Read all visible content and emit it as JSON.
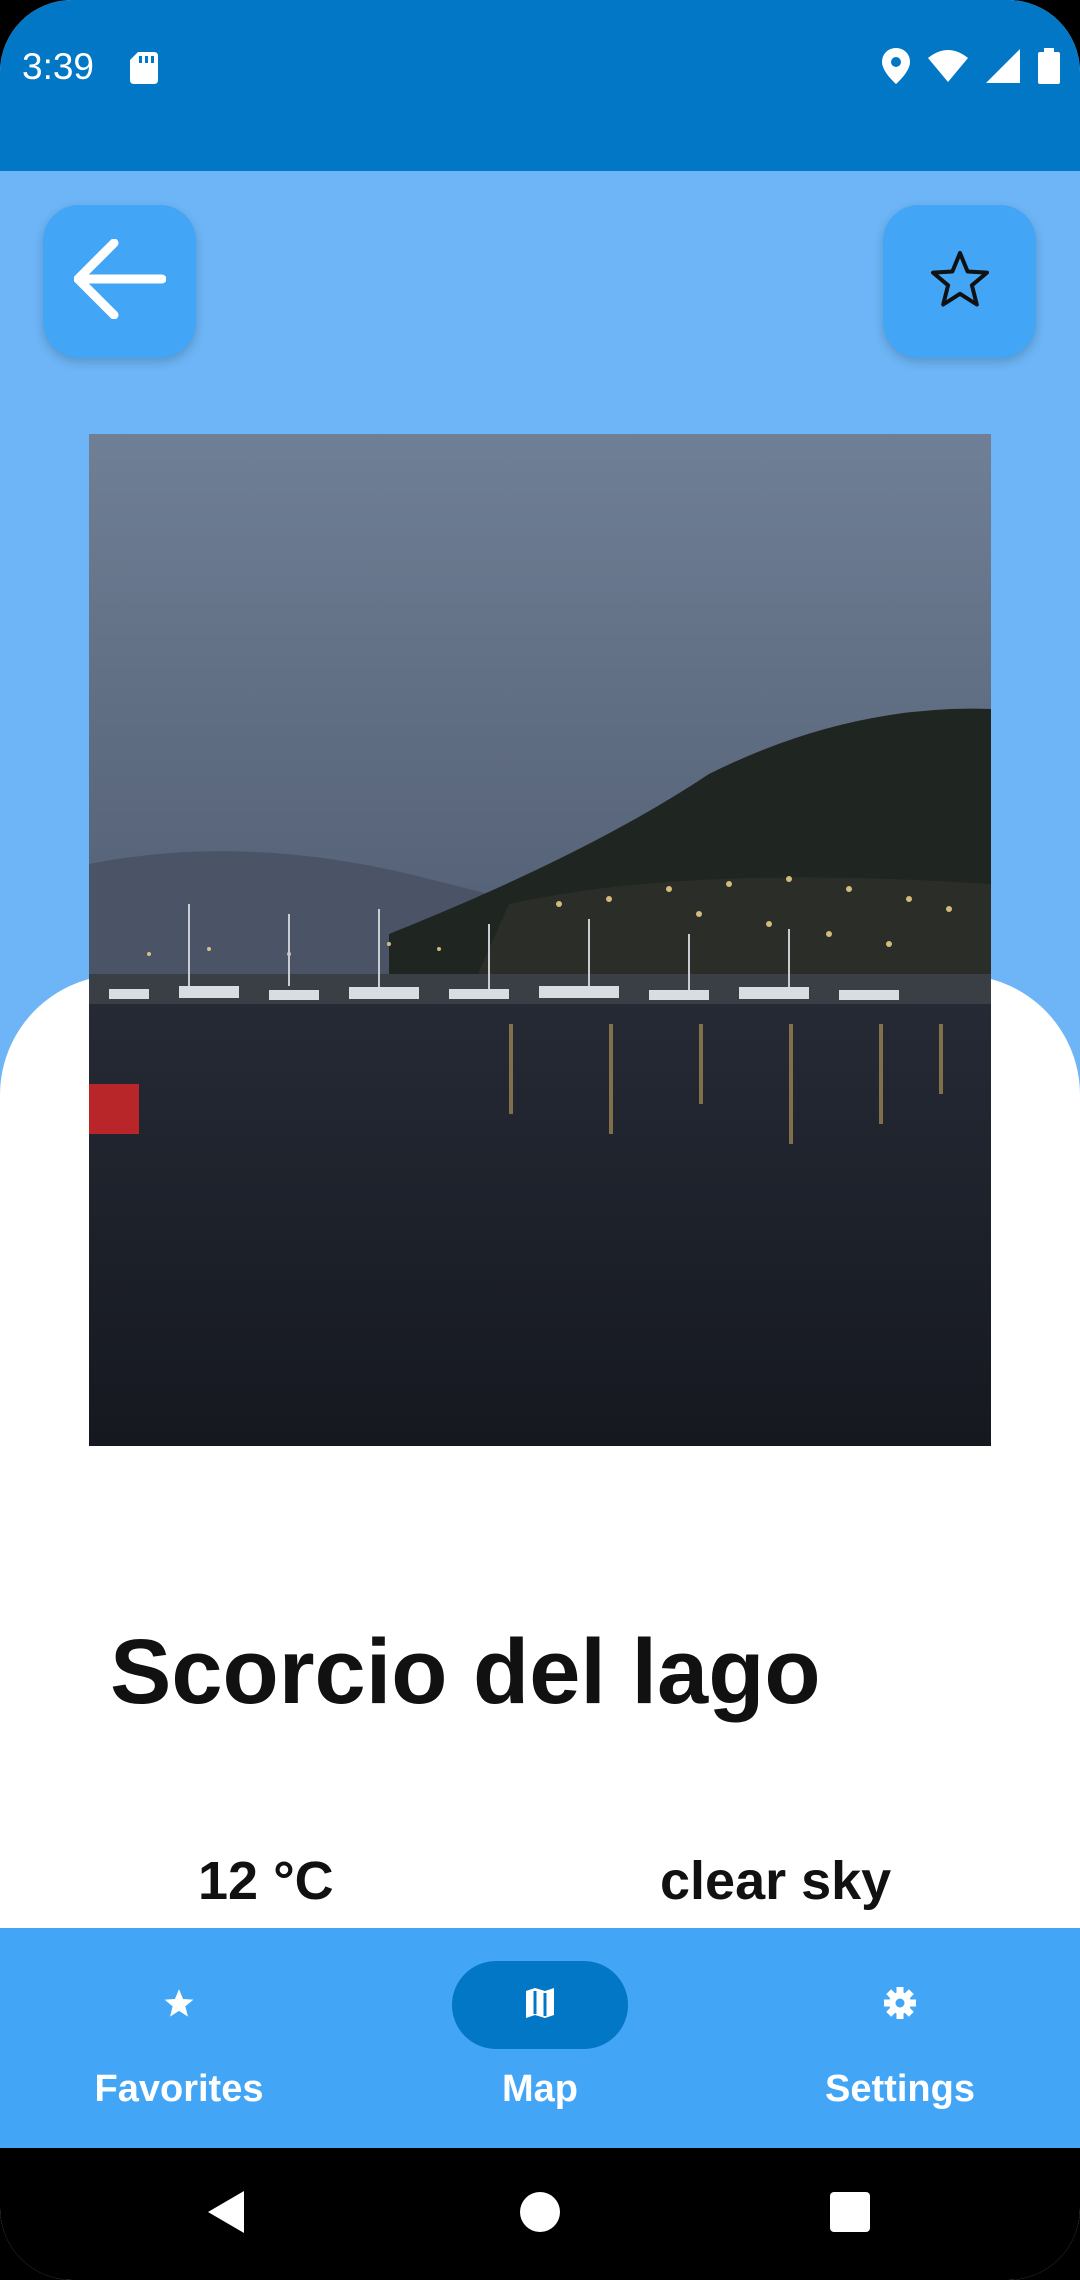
{
  "status_bar": {
    "time": "3:39",
    "icons": [
      "sd-card-icon",
      "location-icon",
      "wifi-icon",
      "signal-icon",
      "battery-icon"
    ],
    "background": "#0277c6"
  },
  "header": {
    "background": "#6db5f6",
    "back_icon": "arrow-left-icon",
    "favorite_icon": "star-outline-icon",
    "button_color": "#42a5f5"
  },
  "photo": {
    "subject": "night view of lake harbor with boats and hillside lights"
  },
  "place": {
    "title": "Scorcio del lago",
    "temperature": "12 °C",
    "weather": "clear sky"
  },
  "bottom_nav": {
    "background": "#42a5f5",
    "active_pill_color": "#0277c6",
    "items": [
      {
        "label": "Favorites",
        "icon": "star-icon",
        "active": false
      },
      {
        "label": "Map",
        "icon": "map-icon",
        "active": true
      },
      {
        "label": "Settings",
        "icon": "gear-icon",
        "active": false
      }
    ]
  },
  "system_nav": {
    "icons": [
      "back-triangle-icon",
      "home-circle-icon",
      "recents-square-icon"
    ]
  }
}
